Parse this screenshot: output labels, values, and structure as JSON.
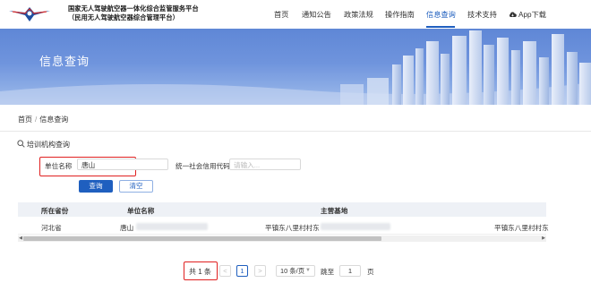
{
  "header": {
    "title_line1": "国家无人驾驶航空器一体化综合监管服务平台",
    "title_line2": "（民用无人驾驶航空器综合管理平台）",
    "nav": [
      "首页",
      "通知公告",
      "政策法规",
      "操作指南",
      "信息查询",
      "技术支持",
      "App下载"
    ],
    "active_nav": "信息查询",
    "accent_color": "#1f5fbf"
  },
  "banner": {
    "title": "信息查询"
  },
  "breadcrumb": {
    "home": "首页",
    "separator": "/",
    "current": "信息查询"
  },
  "section": {
    "title": "培训机构查询",
    "icon": "search-icon"
  },
  "form": {
    "unit_name_label": "单位名称",
    "unit_name_value": "唐山",
    "credit_code_label": "统一社会信用代码",
    "credit_code_placeholder": "请输入...",
    "query_button": "查询",
    "clear_button": "清空"
  },
  "table": {
    "columns": [
      "所在省份",
      "单位名称",
      "主营基地"
    ],
    "rows": [
      {
        "province": "河北省",
        "unit_name": "唐山",
        "base": "平镇东八里村村东",
        "base_extra": "平镇东八里村村东"
      }
    ]
  },
  "pagination": {
    "total": "共 1 条",
    "prev": "<",
    "current_page": "1",
    "next": ">",
    "page_size": "10 条/页",
    "jump_label": "跳至",
    "jump_value": "1",
    "page_label": "页"
  }
}
